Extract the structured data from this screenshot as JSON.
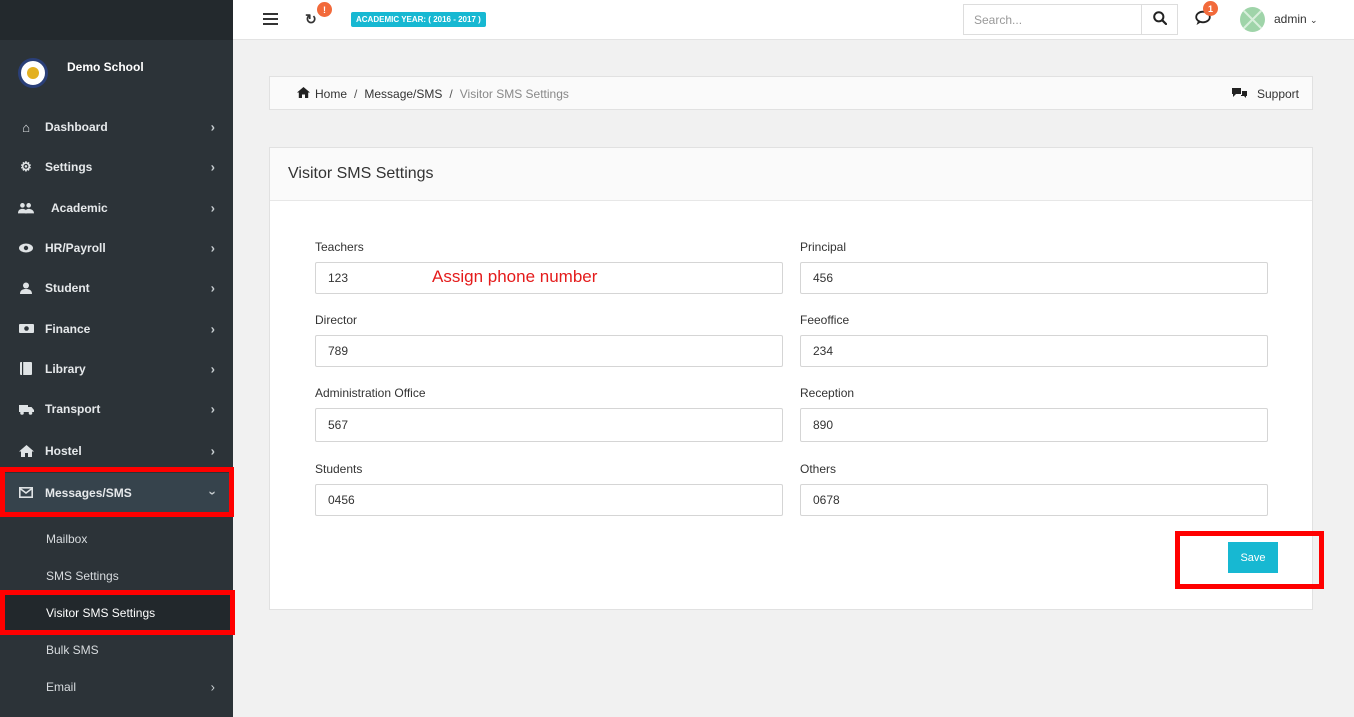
{
  "sidebar": {
    "school_name": "Demo School",
    "items": [
      {
        "label": "Dashboard",
        "icon": "home-icon"
      },
      {
        "label": "Settings",
        "icon": "gears-icon"
      },
      {
        "label": "Academic",
        "icon": "users-icon"
      },
      {
        "label": "HR/Payroll",
        "icon": "eye-icon"
      },
      {
        "label": "Student",
        "icon": "user-icon"
      },
      {
        "label": "Finance",
        "icon": "money-icon"
      },
      {
        "label": "Library",
        "icon": "book-icon"
      },
      {
        "label": "Transport",
        "icon": "truck-icon"
      },
      {
        "label": "Hostel",
        "icon": "house-icon"
      },
      {
        "label": "Messages/SMS",
        "icon": "envelope-icon"
      }
    ],
    "subitems": [
      {
        "label": "Mailbox"
      },
      {
        "label": "SMS Settings"
      },
      {
        "label": "Visitor SMS Settings"
      },
      {
        "label": "Bulk SMS"
      },
      {
        "label": "Email"
      }
    ]
  },
  "topbar": {
    "sync_badge": "!",
    "academic_year": "ACADEMIC YEAR: ( 2016 - 2017 )",
    "search_placeholder": "Search...",
    "chat_badge": "1",
    "username": "admin"
  },
  "breadcrumb": {
    "home": "Home",
    "section": "Message/SMS",
    "current": "Visitor SMS Settings",
    "support": "Support"
  },
  "form": {
    "title": "Visitor SMS Settings",
    "fields": [
      {
        "label": "Teachers",
        "value": "123"
      },
      {
        "label": "Principal",
        "value": "456"
      },
      {
        "label": "Director",
        "value": "789"
      },
      {
        "label": "Feeoffice",
        "value": "234"
      },
      {
        "label": "Administration Office",
        "value": "567"
      },
      {
        "label": "Reception",
        "value": "890"
      },
      {
        "label": "Students",
        "value": "0456"
      },
      {
        "label": "Others",
        "value": "0678"
      }
    ],
    "note": "Assign phone number",
    "save_label": "Save"
  },
  "colors": {
    "sidebar_bg": "#2c3338",
    "accent": "#17b8d2",
    "badge": "#f26a3b",
    "annotation": "#ff0000"
  }
}
